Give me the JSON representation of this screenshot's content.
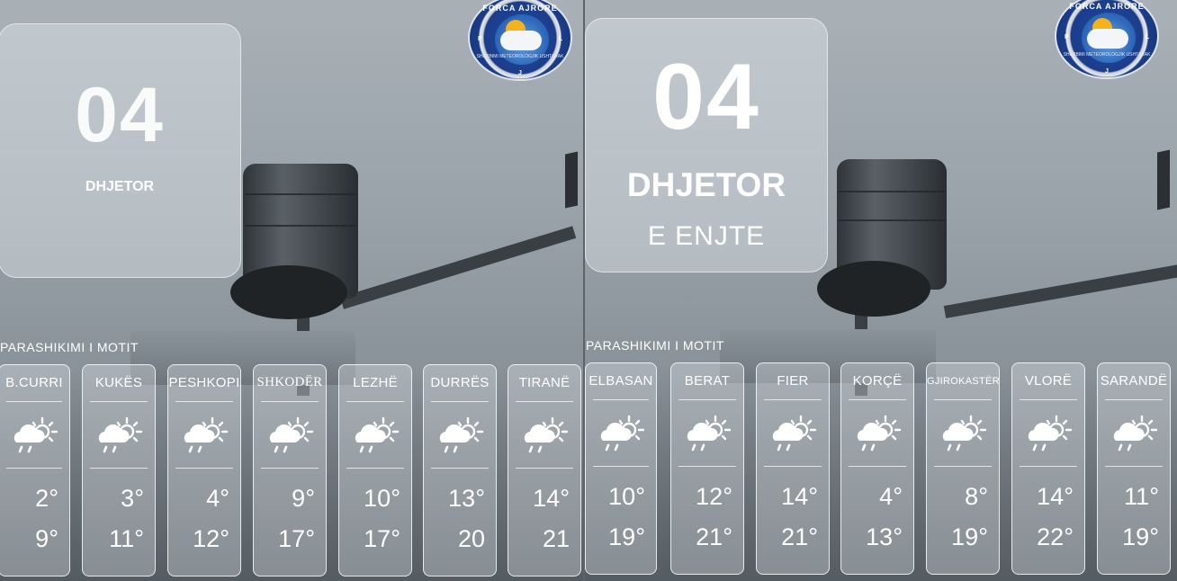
{
  "logo": {
    "title": "FORCA AJRORE",
    "subtitle": "SHERBIMI METEOROLOGJIK USHTARAK",
    "letters": [
      "P",
      "L",
      "J"
    ],
    "colors": {
      "ring": "#1b3d8a",
      "sun": "#f5b21d"
    }
  },
  "left_panel": {
    "date": {
      "day_number": "04",
      "month": "DHJETOR"
    },
    "section_title": "PARASHIKIMI I MOTIT",
    "cities": [
      {
        "name": "B.CURRI",
        "icon": "cloud-sun-rain-icon",
        "min": "2°",
        "max": "9°"
      },
      {
        "name": "KUKËS",
        "icon": "cloud-sun-rain-icon",
        "min": "3°",
        "max": "11°"
      },
      {
        "name": "PESHKOPI",
        "icon": "cloud-sun-rain-icon",
        "min": "4°",
        "max": "12°"
      },
      {
        "name": "SHKODËR",
        "icon": "cloud-sun-rain-icon",
        "min": "9°",
        "max": "17°"
      },
      {
        "name": "LEZHË",
        "icon": "cloud-sun-rain-icon",
        "min": "10°",
        "max": "17°"
      },
      {
        "name": "DURRËS",
        "icon": "cloud-sun-rain-icon",
        "min": "13°",
        "max": "20"
      },
      {
        "name": "TIRANË",
        "icon": "cloud-sun-rain-icon",
        "min": "14°",
        "max": "21"
      }
    ]
  },
  "right_panel": {
    "date": {
      "day_number": "04",
      "month": "DHJETOR",
      "weekday": "E ENJTE"
    },
    "section_title": "PARASHIKIMI I MOTIT",
    "cities": [
      {
        "name": "ELBASAN",
        "icon": "cloud-sun-rain-icon",
        "min": "10°",
        "max": "19°"
      },
      {
        "name": "BERAT",
        "icon": "cloud-sun-rain-icon",
        "min": "12°",
        "max": "21°"
      },
      {
        "name": "FIER",
        "icon": "cloud-sun-rain-icon",
        "min": "14°",
        "max": "21°"
      },
      {
        "name": "KORÇË",
        "icon": "cloud-sun-rain-icon",
        "min": "4°",
        "max": "13°"
      },
      {
        "name": "GJIROKASTËR",
        "icon": "cloud-sun-rain-icon",
        "min": "8°",
        "max": "19°"
      },
      {
        "name": "VLORË",
        "icon": "cloud-sun-rain-icon",
        "min": "14°",
        "max": "22°"
      },
      {
        "name": "SARANDË",
        "icon": "cloud-sun-rain-icon",
        "min": "11°",
        "max": "19°"
      }
    ]
  }
}
